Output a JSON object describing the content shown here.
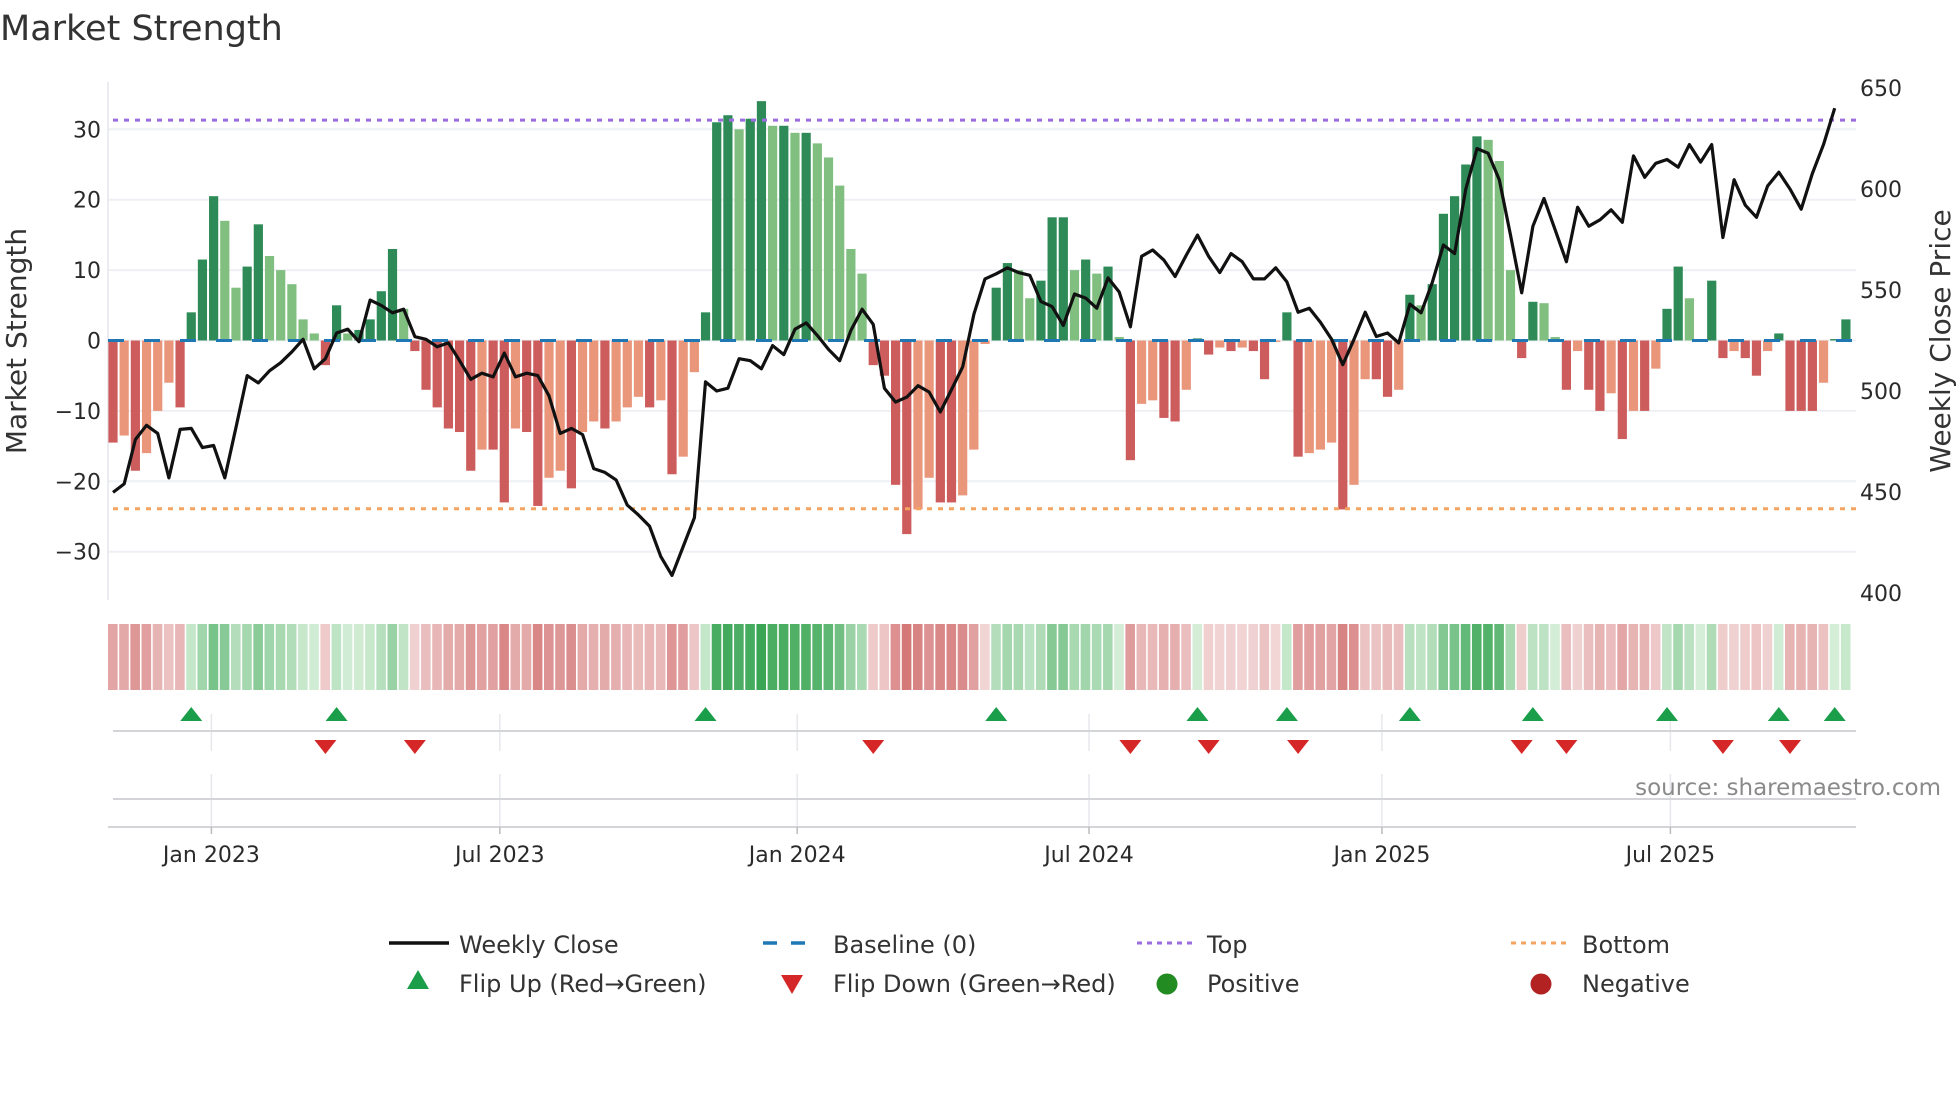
{
  "title": "Market Strength",
  "source_note": "source: sharemaestro.com",
  "colors": {
    "pos_rising": "#2e8b57",
    "pos_falling": "#80bf80",
    "neg_falling": "#cd5c5c",
    "neg_rising": "#e9967a",
    "baseline": "#1f77b4",
    "top": "#9b6ddf",
    "bottom": "#f4a460",
    "flip_up": "#1a9e4a",
    "flip_down": "#d62728",
    "positive": "#228b22",
    "negative": "#b22222",
    "close": "#111111"
  },
  "chart_data": {
    "type": "bar+line",
    "title": "Market Strength",
    "ylabel": "Market Strength",
    "y2label": "Weekly Close Price",
    "ylim": [
      -37,
      38
    ],
    "y2lim": [
      400,
      650
    ],
    "yticks": [
      30,
      20,
      10,
      0,
      -10,
      -20,
      -30
    ],
    "ytick_labels": [
      "30",
      "20",
      "10",
      "0",
      "−10",
      "−20",
      "−30"
    ],
    "y2ticks": [
      650,
      600,
      550,
      500,
      450,
      400
    ],
    "y2tick_labels": [
      "650",
      "600",
      "550",
      "500",
      "450",
      "400"
    ],
    "top_level": 31.3,
    "bottom_level": -23.9,
    "xticks": [
      {
        "week": 8.8,
        "label": "Jan 2023"
      },
      {
        "week": 34.6,
        "label": "Jul 2023"
      },
      {
        "week": 61.2,
        "label": "Jan 2024"
      },
      {
        "week": 87.3,
        "label": "Jul 2024"
      },
      {
        "week": 113.5,
        "label": "Jan 2025"
      },
      {
        "week": 139.3,
        "label": "Jul 2025"
      }
    ],
    "strength": [
      -14.5,
      -13.5,
      -18.5,
      -16,
      -10,
      -6,
      -9.5,
      4,
      11.5,
      20.5,
      17,
      7.5,
      10.5,
      16.5,
      12,
      10,
      8,
      3,
      1,
      -3.5,
      5,
      1,
      1.5,
      3,
      7,
      13,
      4.5,
      -1.5,
      -7,
      -9.5,
      -12.5,
      -13,
      -18.5,
      -15.5,
      -15.5,
      -23,
      -12.5,
      -13,
      -23.5,
      -19.5,
      -18.5,
      -21,
      -13,
      -11.5,
      -12.5,
      -11.5,
      -9.5,
      -8,
      -9.5,
      -8.5,
      -19,
      -16.5,
      -4.5,
      4,
      31,
      32,
      30,
      31.5,
      34,
      30.5,
      30.5,
      29.5,
      29.5,
      28,
      26,
      22,
      13,
      9.5,
      -3.5,
      -5,
      -20.5,
      -27.5,
      -24,
      -19.5,
      -23,
      -23,
      -22,
      -15.5,
      -0.5,
      7.5,
      11,
      10,
      6,
      8.5,
      17.5,
      17.5,
      10,
      11.5,
      9.5,
      10.5,
      0.5,
      -17,
      -9,
      -8.5,
      -11,
      -11.5,
      -7,
      0.3,
      -2,
      -1,
      -1.5,
      -1,
      -1.5,
      -5.5,
      -0.2,
      4,
      -16.5,
      -16,
      -15.5,
      -14.5,
      -24,
      -20.5,
      -5.5,
      -5.5,
      -8,
      -7,
      6.5,
      5,
      8,
      18,
      20.5,
      25,
      29,
      28.5,
      25.5,
      10,
      -2.5,
      5.5,
      5.3,
      0.5,
      -7,
      -1.5,
      -7,
      -10,
      -7.5,
      -14,
      -10,
      -10,
      -4,
      4.5,
      10.5,
      6,
      0.2,
      8.5,
      -2.5,
      -1.5,
      -2.5,
      -5,
      -1.5,
      1,
      -10,
      -10,
      -10,
      -6,
      0.2,
      3
    ],
    "weekly_close": [
      449.8,
      454,
      476,
      483,
      479,
      457,
      481,
      481.5,
      472,
      473,
      457,
      482,
      507.6,
      504,
      510,
      514,
      519.4,
      525.6,
      511,
      516,
      528.7,
      530.6,
      524.4,
      545,
      542.4,
      538.7,
      540.5,
      526.9,
      525.6,
      521.9,
      523.8,
      515,
      505.8,
      508.8,
      507,
      518.8,
      507,
      508.8,
      507.6,
      497.6,
      479,
      481.5,
      478.4,
      461.6,
      459.7,
      456,
      443.5,
      438.6,
      433,
      418,
      408.7,
      423,
      437.3,
      504.5,
      500,
      501.4,
      516,
      515,
      511,
      522.5,
      518,
      530.6,
      533.7,
      527.5,
      520.6,
      515,
      530,
      540.5,
      533,
      501.4,
      494.5,
      497,
      502.6,
      499.5,
      489.6,
      500.7,
      512,
      538,
      555.5,
      558,
      561,
      558.6,
      557.3,
      544.3,
      541.8,
      532.5,
      548,
      546,
      541,
      556,
      549,
      531.8,
      566.7,
      569.8,
      564.8,
      556.7,
      567.3,
      577.2,
      566.7,
      558.6,
      568,
      564,
      555.5,
      555.5,
      561,
      554,
      539,
      541,
      534,
      525.6,
      513,
      525.6,
      539,
      527,
      528.7,
      523.8,
      543,
      538.7,
      553.6,
      572.3,
      568,
      600,
      620,
      617.7,
      604.6,
      577.2,
      548.6,
      581.6,
      595.3,
      579.7,
      564,
      591,
      581.6,
      584.7,
      589.7,
      583.5,
      616.4,
      605.8,
      612.7,
      614.6,
      610.8,
      622,
      613.3,
      622,
      576,
      604.6,
      592,
      586,
      601.5,
      608.3,
      600,
      590,
      607.7,
      622,
      640
    ]
  },
  "legend": {
    "weekly_close": "Weekly Close",
    "baseline": "Baseline (0)",
    "top": "Top",
    "bottom": "Bottom",
    "flip_up": "Flip Up (Red→Green)",
    "flip_down": "Flip Down (Green→Red)",
    "positive": "Positive",
    "negative": "Negative"
  }
}
